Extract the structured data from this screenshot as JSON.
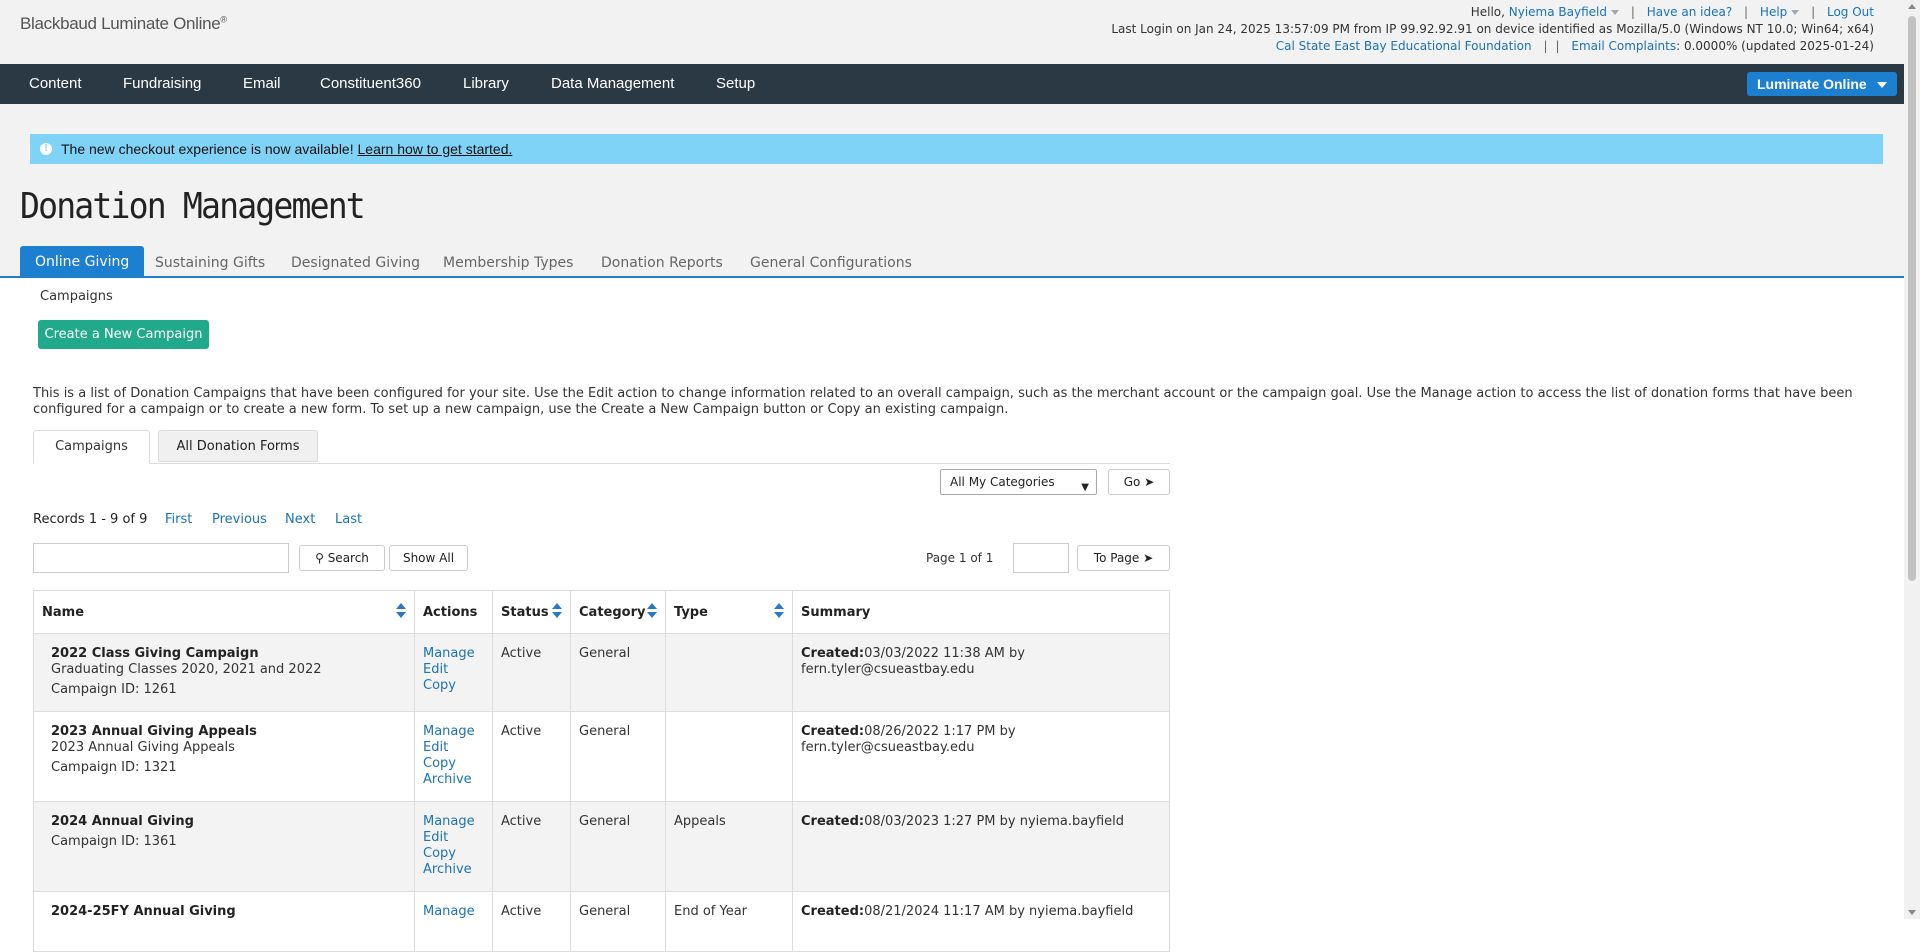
{
  "header": {
    "brand": "Blackbaud Luminate Online",
    "brand_mark": "®",
    "hello": "Hello,",
    "user_name": "Nyiema Bayfield",
    "have_idea": "Have an idea?",
    "help": "Help",
    "logout": "Log Out",
    "last_login": "Last Login on Jan 24, 2025 13:57:09 PM from IP 99.92.92.91 on device identified as Mozilla/5.0 (Windows NT 10.0; Win64; x64)",
    "org_name": "Cal State East Bay Educational Foundation",
    "email_complaints_label": "Email Complaints",
    "email_complaints_value": ": 0.0000% (updated 2025-01-24)"
  },
  "nav": {
    "items": [
      "Content",
      "Fundraising",
      "Email",
      "Constituent360",
      "Library",
      "Data Management",
      "Setup"
    ],
    "product_button": "Luminate Online"
  },
  "alert": {
    "text": "The new checkout experience is now available!",
    "link": "Learn how to get started."
  },
  "page": {
    "title": "Donation Management",
    "tabs": [
      "Online Giving",
      "Sustaining Gifts",
      "Designated Giving",
      "Membership Types",
      "Donation Reports",
      "General Configurations"
    ],
    "breadcrumb": "Campaigns",
    "create_button": "Create a New Campaign",
    "description": "This is a list of Donation Campaigns that have been configured for your site. Use the Edit action to change information related to an overall campaign, such as the merchant account or the campaign goal. Use the Manage action to access the list of donation forms that have been configured for a campaign or to create a new form. To set up a new campaign, use the Create a New Campaign button or Copy an existing campaign."
  },
  "sub_tabs": [
    "Campaigns",
    "All Donation Forms"
  ],
  "filter": {
    "category_selected": "All My Categories",
    "go_button": "Go"
  },
  "pager": {
    "records": "Records 1 - 9 of 9",
    "first": "First",
    "previous": "Previous",
    "next": "Next",
    "last": "Last",
    "search_button": "Search",
    "show_all_button": "Show All",
    "page_of": "Page 1 of 1",
    "to_page_button": "To Page"
  },
  "table": {
    "headers": [
      "Name",
      "Actions",
      "Status",
      "Category",
      "Type",
      "Summary"
    ],
    "rows": [
      {
        "name": "2022 Class Giving Campaign",
        "subtitle": "Graduating Classes 2020, 2021 and 2022",
        "campaign_id": "Campaign ID: 1261",
        "actions": [
          "Manage",
          "Edit",
          "Copy"
        ],
        "status": "Active",
        "category": "General",
        "type": "",
        "created_label": "Created:",
        "created": "03/03/2022 11:38 AM by fern.tyler@csueastbay.edu"
      },
      {
        "name": "2023 Annual Giving Appeals",
        "subtitle": "2023 Annual Giving Appeals",
        "campaign_id": "Campaign ID: 1321",
        "actions": [
          "Manage",
          "Edit",
          "Copy",
          "Archive"
        ],
        "status": "Active",
        "category": "General",
        "type": "",
        "created_label": "Created:",
        "created": "08/26/2022 1:17 PM by fern.tyler@csueastbay.edu"
      },
      {
        "name": "2024 Annual Giving",
        "subtitle": "",
        "campaign_id": "Campaign ID: 1361",
        "actions": [
          "Manage",
          "Edit",
          "Copy",
          "Archive"
        ],
        "status": "Active",
        "category": "General",
        "type": "Appeals",
        "created_label": "Created:",
        "created": "08/03/2023 1:27 PM by nyiema.bayfield"
      },
      {
        "name": "2024-25FY Annual Giving",
        "subtitle": "",
        "campaign_id": "",
        "actions": [
          "Manage"
        ],
        "status": "Active",
        "category": "General",
        "type": "End of Year",
        "created_label": "Created:",
        "created": "08/21/2024 11:17 AM by nyiema.bayfield"
      }
    ]
  },
  "colors": {
    "nav_bg": "#2b3945",
    "accent_blue": "#1d7fd0",
    "create_green": "#20a98a",
    "alert_bg": "#7fd3f7",
    "link": "#1a73b5"
  }
}
